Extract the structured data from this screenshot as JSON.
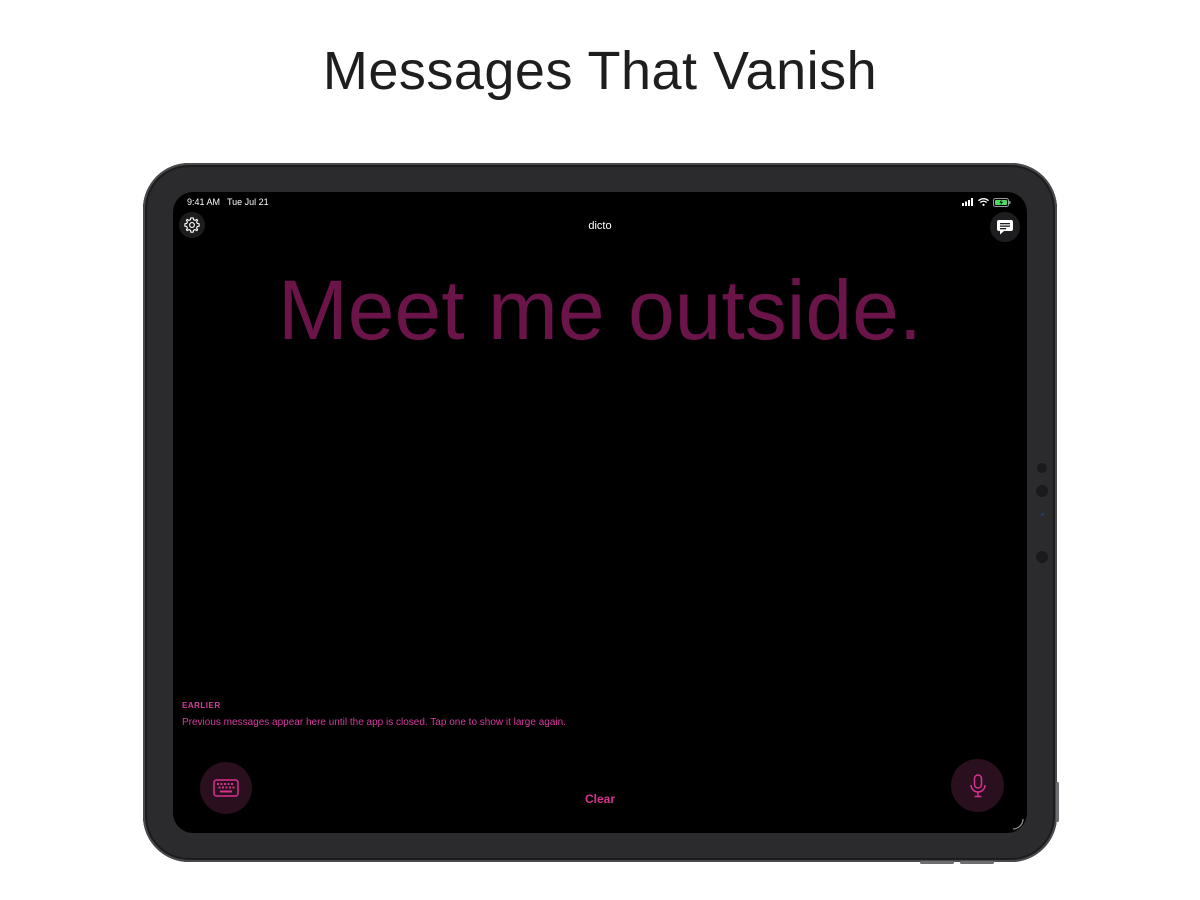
{
  "page": {
    "title": "Messages That Vanish"
  },
  "status_bar": {
    "time": "9:41 AM",
    "date": "Tue Jul 21"
  },
  "nav": {
    "title": "dicto",
    "settings_icon": "gear-icon",
    "messages_icon": "chat-bubble-icon"
  },
  "message": {
    "text": "Meet me outside."
  },
  "history": {
    "label": "EARLIER",
    "hint": "Previous messages appear here until the app is closed. Tap one to show it large again."
  },
  "toolbar": {
    "keyboard_icon": "keyboard-icon",
    "clear_label": "Clear",
    "mic_icon": "microphone-icon"
  },
  "colors": {
    "accent": "#d6328f",
    "message_text": "#6b1449",
    "button_bg": "#2a0f1f",
    "screen_bg": "#000000",
    "battery_green": "#4cd964"
  }
}
